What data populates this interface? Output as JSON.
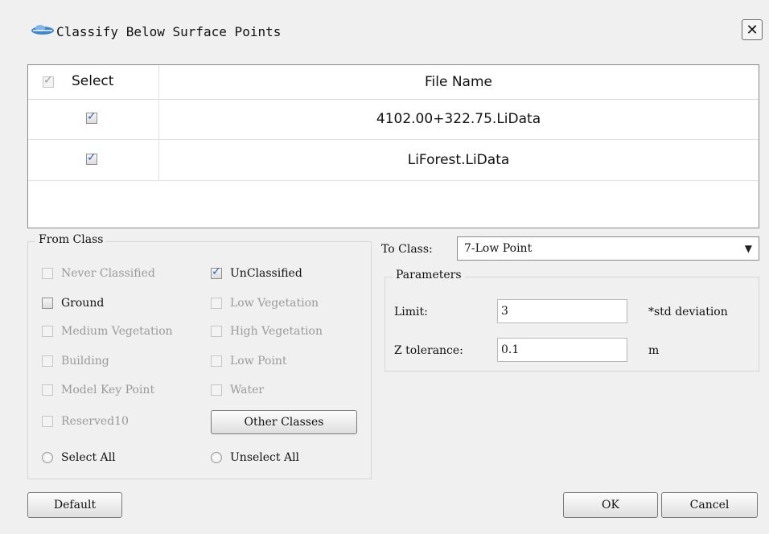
{
  "window": {
    "title": "Classify Below Surface Points",
    "close_symbol": "✕"
  },
  "file_table": {
    "columns": {
      "select": "Select",
      "file_name": "File Name"
    },
    "header_checked": true,
    "rows": [
      {
        "selected": true,
        "file_name": "4102.00+322.75.LiData"
      },
      {
        "selected": true,
        "file_name": "LiForest.LiData"
      }
    ]
  },
  "from_class": {
    "title": "From Class",
    "options": [
      {
        "label": "Never Classified",
        "checked": false,
        "enabled": false
      },
      {
        "label": "UnClassified",
        "checked": true,
        "enabled": true
      },
      {
        "label": "Ground",
        "checked": false,
        "enabled": true
      },
      {
        "label": "Low Vegetation",
        "checked": false,
        "enabled": false
      },
      {
        "label": "Medium Vegetation",
        "checked": false,
        "enabled": false
      },
      {
        "label": "High Vegetation",
        "checked": false,
        "enabled": false
      },
      {
        "label": "Building",
        "checked": false,
        "enabled": false
      },
      {
        "label": "Low Point",
        "checked": false,
        "enabled": false
      },
      {
        "label": "Model Key Point",
        "checked": false,
        "enabled": false
      },
      {
        "label": "Water",
        "checked": false,
        "enabled": false
      },
      {
        "label": "Reserved10",
        "checked": false,
        "enabled": false
      }
    ],
    "other_classes_button": "Other Classes",
    "select_all": "Select All",
    "unselect_all": "Unselect All"
  },
  "to_class": {
    "label": "To Class:",
    "value": "7-Low Point"
  },
  "parameters": {
    "title": "Parameters",
    "limit": {
      "label": "Limit:",
      "value": "3",
      "unit": "*std deviation"
    },
    "z_tolerance": {
      "label": "Z tolerance:",
      "value": "0.1",
      "unit": "m"
    }
  },
  "buttons": {
    "default": "Default",
    "ok": "OK",
    "cancel": "Cancel"
  },
  "colors": {
    "dialog_bg": "#f0f0f0",
    "check_mark": "#2b5fb3",
    "disabled_text": "#9a9a9a"
  }
}
